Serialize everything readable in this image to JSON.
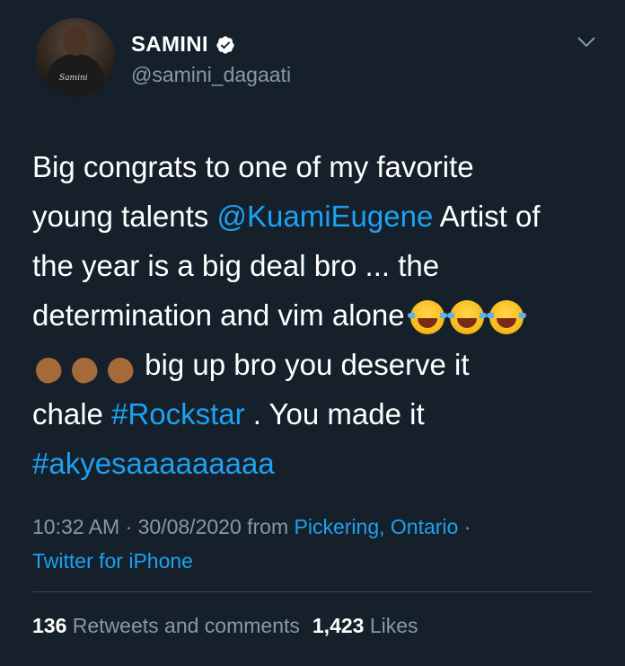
{
  "colors": {
    "background": "#15202b",
    "text": "#ffffff",
    "secondary": "#8899a6",
    "link": "#1da1f2",
    "divider": "#38444d"
  },
  "user": {
    "display_name": "SAMINI",
    "handle": "@samini_dagaati",
    "verified_icon": "verified-badge-icon",
    "avatar_logo_text": "Samini"
  },
  "tweet": {
    "line1": "Big congrats to one of my favorite",
    "line2_pre": "young talents ",
    "mention": "@KuamiEugene",
    "line2_post": " Artist of",
    "line3": "the year is a big deal bro ... the",
    "line4": "determination and vim alone",
    "line5": "big up bro you deserve it",
    "line6_pre": "chale ",
    "hashtag1": "#Rockstar",
    "line6_post": " . You made it",
    "hashtag2": "#akyesaaaaaaaaa",
    "emojis": [
      "face-with-tears-of-joy",
      "face-with-tears-of-joy",
      "face-with-tears-of-joy",
      "clapping-hands-dark",
      "clapping-hands-dark",
      "clapping-hands-dark"
    ]
  },
  "meta": {
    "time_date": "10:32 AM · 30/08/2020 from ",
    "location": "Pickering, Ontario",
    "separator": " ·",
    "source": "Twitter for iPhone"
  },
  "stats": {
    "retweets_count": "136",
    "retweets_label": " Retweets and comments",
    "likes_count": "1,423",
    "likes_label": " Likes"
  }
}
